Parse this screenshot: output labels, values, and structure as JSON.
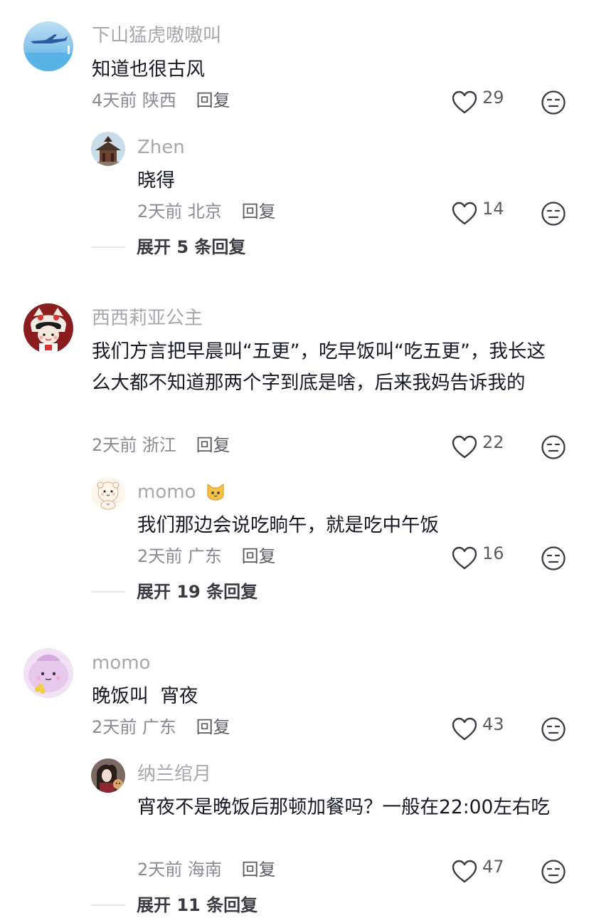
{
  "comments": [
    {
      "name": "下山猛虎嗷嗷叫",
      "text": "知道也很古风",
      "time": "4天前",
      "location": "陕西",
      "reply_label": "回复",
      "likes": "29",
      "reply": {
        "name": "Zhen",
        "text": "晓得",
        "time": "2天前",
        "location": "北京",
        "reply_label": "回复",
        "likes": "14"
      },
      "expand_label": "展开 5 条回复"
    },
    {
      "name": "西西莉亚公主",
      "text": "我们方言把早晨叫“五更”，吃早饭叫“吃五更”，我长这么大都不知道那两个字到底是啥，后来我妈告诉我的",
      "time": "2天前",
      "location": "浙江",
      "reply_label": "回复",
      "likes": "22",
      "reply": {
        "name": "momo",
        "text": "我们那边会说吃晌午，就是吃中午饭",
        "time": "2天前",
        "location": "广东",
        "reply_label": "回复",
        "likes": "16"
      },
      "expand_label": "展开 19 条回复"
    },
    {
      "name": "momo",
      "text": "晚饭叫  宵夜",
      "time": "2天前",
      "location": "广东",
      "reply_label": "回复",
      "likes": "43",
      "reply": {
        "name": "纳兰绾月",
        "text": "宵夜不是晚饭后那顿加餐吗？一般在22:00左右吃",
        "time": "2天前",
        "location": "海南",
        "reply_label": "回复",
        "likes": "47"
      },
      "expand_label": "展开 11 条回复"
    }
  ],
  "icons": {
    "like": "heart-outline-icon",
    "dislike": "neutral-face-icon",
    "badge": "cat-emoji"
  },
  "colors": {
    "name": "#a7a8ad",
    "text": "#161823",
    "meta": "#8a8b91"
  }
}
